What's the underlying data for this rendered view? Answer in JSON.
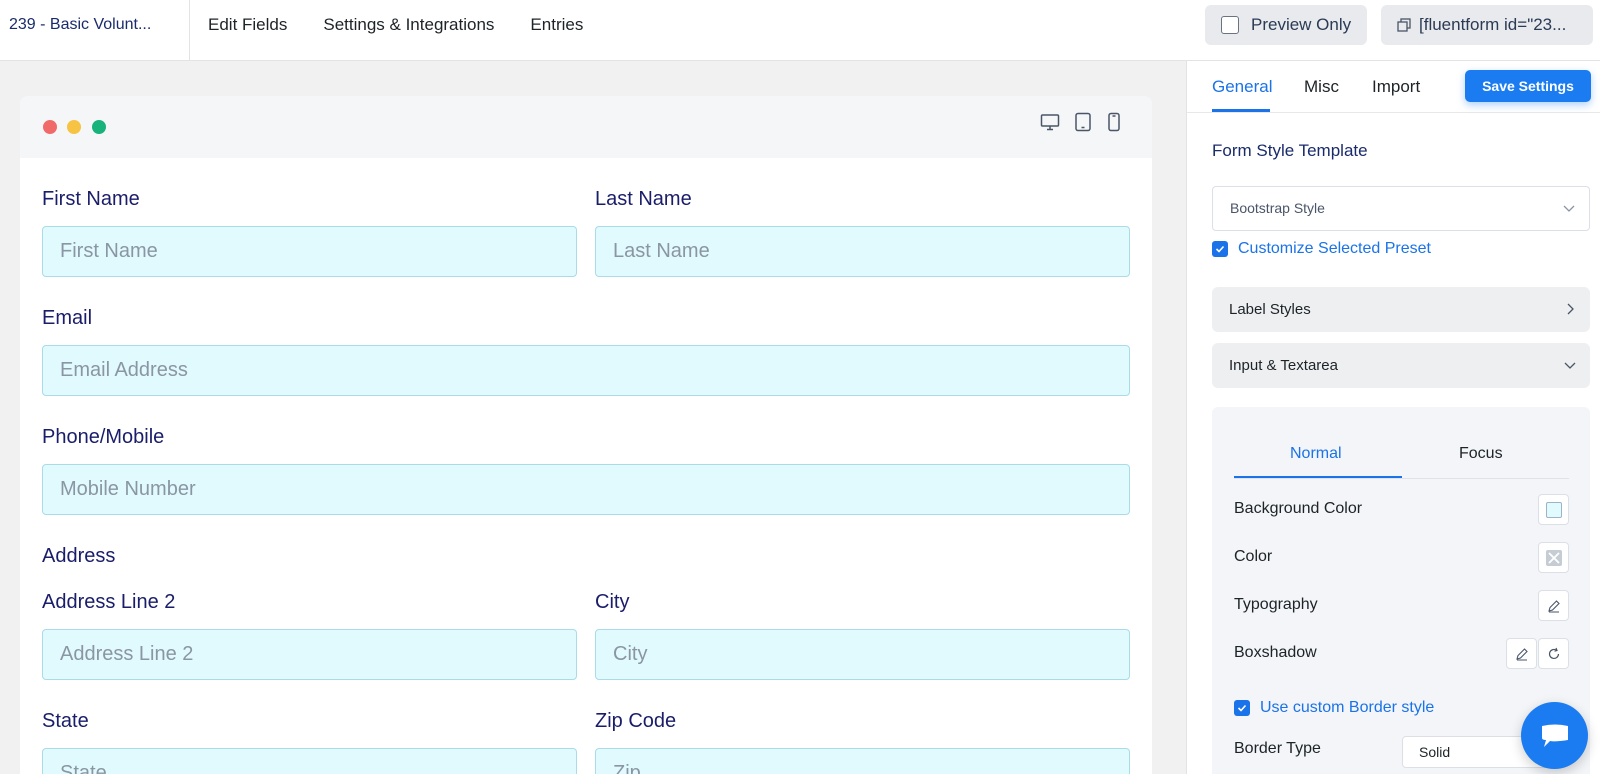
{
  "topbar": {
    "form_title": "239 - Basic Volunt...",
    "nav": [
      "Edit Fields",
      "Settings & Integrations",
      "Entries"
    ],
    "preview_label": "Preview Only",
    "shortcode_label": "[fluentform id=\"23..."
  },
  "preview": {
    "devices": [
      "desktop-icon",
      "tablet-icon",
      "mobile-icon"
    ],
    "fields": {
      "first_name": {
        "label": "First Name",
        "placeholder": "First Name"
      },
      "last_name": {
        "label": "Last Name",
        "placeholder": "Last Name"
      },
      "email": {
        "label": "Email",
        "placeholder": "Email Address"
      },
      "phone": {
        "label": "Phone/Mobile",
        "placeholder": "Mobile Number"
      },
      "address_heading": "Address",
      "address_line2": {
        "label": "Address Line 2",
        "placeholder": "Address Line 2"
      },
      "city": {
        "label": "City",
        "placeholder": "City"
      },
      "state": {
        "label": "State",
        "placeholder": "State"
      },
      "zip": {
        "label": "Zip Code",
        "placeholder": "Zip"
      }
    }
  },
  "sidebar": {
    "tabs": [
      "General",
      "Misc",
      "Import"
    ],
    "active_tab": "General",
    "save_label": "Save Settings",
    "template_title": "Form Style Template",
    "template_value": "Bootstrap Style",
    "customize_preset_label": "Customize Selected Preset",
    "accordions": [
      "Label Styles",
      "Input & Textarea"
    ],
    "sub_tabs": [
      "Normal",
      "Focus"
    ],
    "properties": {
      "background_color": "Background Color",
      "color": "Color",
      "typography": "Typography",
      "boxshadow": "Boxshadow"
    },
    "custom_border_label": "Use custom Border style",
    "border_type_label": "Border Type",
    "border_type_value": "Solid"
  },
  "colors": {
    "accent": "#1a73e8",
    "input_bg": "#e1fafe",
    "label": "#1a1d6a"
  }
}
